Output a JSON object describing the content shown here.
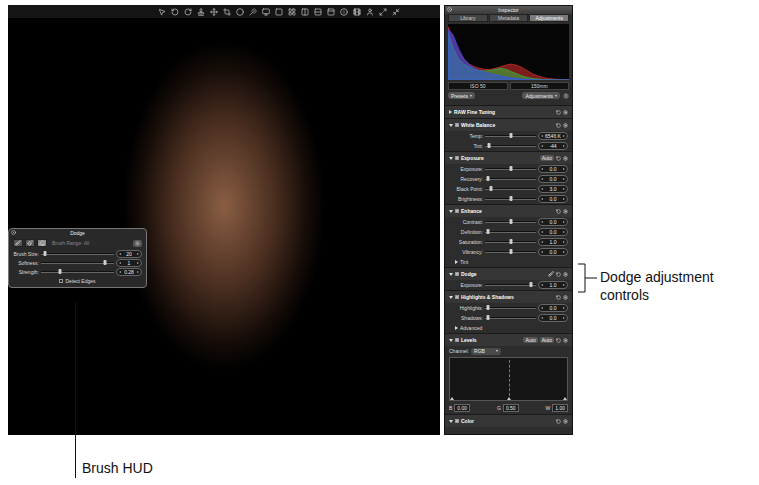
{
  "inspector": {
    "title": "Inspector",
    "tabs": [
      {
        "label": "Library",
        "selected": false
      },
      {
        "label": "Metadata",
        "selected": false
      },
      {
        "label": "Adjustments",
        "selected": true
      }
    ],
    "histogram": {
      "red": [
        100,
        80,
        55,
        40,
        30,
        25,
        22,
        20,
        20,
        22,
        25,
        28,
        30,
        28,
        24,
        18,
        12,
        8,
        5,
        3,
        2,
        1,
        1,
        0
      ],
      "green": [
        90,
        60,
        40,
        30,
        25,
        20,
        18,
        17,
        18,
        20,
        22,
        20,
        16,
        12,
        8,
        5,
        3,
        2,
        1,
        1,
        0,
        0,
        0,
        0
      ],
      "blue": [
        95,
        85,
        60,
        40,
        30,
        22,
        18,
        15,
        12,
        10,
        8,
        6,
        4,
        3,
        2,
        1,
        1,
        0,
        0,
        0,
        0,
        0,
        0,
        0
      ]
    },
    "info": [
      "ISO 50",
      "150mm"
    ],
    "presets": "Presets",
    "adjustments": "Adjustments",
    "sections": [
      {
        "title": "RAW Fine Tuning",
        "expanded": false,
        "rows": []
      },
      {
        "title": "White Balance",
        "expanded": true,
        "checked": true,
        "rows": [
          {
            "kind": "slider",
            "label": "Temp:",
            "level": 0.5,
            "value": "6546 K"
          },
          {
            "kind": "slider",
            "label": "Tint:",
            "level": 0.08,
            "value": "-44"
          }
        ]
      },
      {
        "title": "Exposure",
        "expanded": true,
        "checked": true,
        "badges": [
          "Auto"
        ],
        "rows": [
          {
            "kind": "slider",
            "label": "Exposure:",
            "level": 0.5,
            "value": "0.0"
          },
          {
            "kind": "slider",
            "label": "Recovery:",
            "level": 0.05,
            "value": "0.0"
          },
          {
            "kind": "slider",
            "label": "Black Point:",
            "level": 0.12,
            "value": "3.0"
          },
          {
            "kind": "slider",
            "label": "Brightness:",
            "level": 0.5,
            "value": "0.0"
          }
        ]
      },
      {
        "title": "Enhance",
        "expanded": true,
        "checked": true,
        "rows": [
          {
            "kind": "slider",
            "label": "Contrast:",
            "level": 0.5,
            "value": "0.0"
          },
          {
            "kind": "slider",
            "label": "Definition:",
            "level": 0.05,
            "value": "0.0"
          },
          {
            "kind": "slider",
            "label": "Saturation:",
            "level": 0.5,
            "value": "1.0"
          },
          {
            "kind": "slider",
            "label": "Vibrancy:",
            "level": 0.5,
            "value": "0.0"
          },
          {
            "kind": "disclosure",
            "label": "Tint",
            "expanded": false
          }
        ]
      },
      {
        "title": "Dodge",
        "expanded": true,
        "checked": true,
        "brush": true,
        "rows": [
          {
            "kind": "slider",
            "label": "Exposure:",
            "level": 0.9,
            "value": "1.0"
          }
        ]
      },
      {
        "title": "Highlights & Shadows",
        "expanded": true,
        "checked": true,
        "rows": [
          {
            "kind": "slider",
            "label": "Highlights:",
            "level": 0.05,
            "value": "0.0"
          },
          {
            "kind": "slider",
            "label": "Shadows:",
            "level": 0.05,
            "value": "0.0"
          },
          {
            "kind": "disclosure",
            "label": "Advanced",
            "expanded": false
          }
        ]
      },
      {
        "title": "Levels",
        "expanded": true,
        "checked": true,
        "badges": [
          "Auto",
          "Auto"
        ],
        "rows": [
          {
            "kind": "select",
            "label": "Channel:",
            "value": "RGB"
          },
          {
            "kind": "graph"
          },
          {
            "kind": "levels",
            "items": [
              {
                "label": "B",
                "value": "0.00"
              },
              {
                "label": "G",
                "value": "0.50"
              },
              {
                "label": "W",
                "value": "1.00"
              }
            ]
          }
        ]
      },
      {
        "title": "Color",
        "expanded": true,
        "checked": true,
        "rows": []
      }
    ]
  },
  "hud": {
    "title": "Dodge",
    "brushRange": "Brush Range: All",
    "tools": [
      {
        "selected": false
      },
      {
        "selected": false
      },
      {
        "selected": true
      }
    ],
    "sliders": [
      {
        "label": "Brush Size:",
        "level": 0.06,
        "value": "20"
      },
      {
        "label": "Softness:",
        "level": 0.88,
        "value": "1"
      },
      {
        "label": "Strength:",
        "level": 0.26,
        "value": "0.28"
      }
    ],
    "detectEdges": {
      "label": "Detect Edges",
      "checked": false
    }
  },
  "annotations": {
    "dodge": "Dodge adjustment controls",
    "hud": "Brush HUD"
  }
}
